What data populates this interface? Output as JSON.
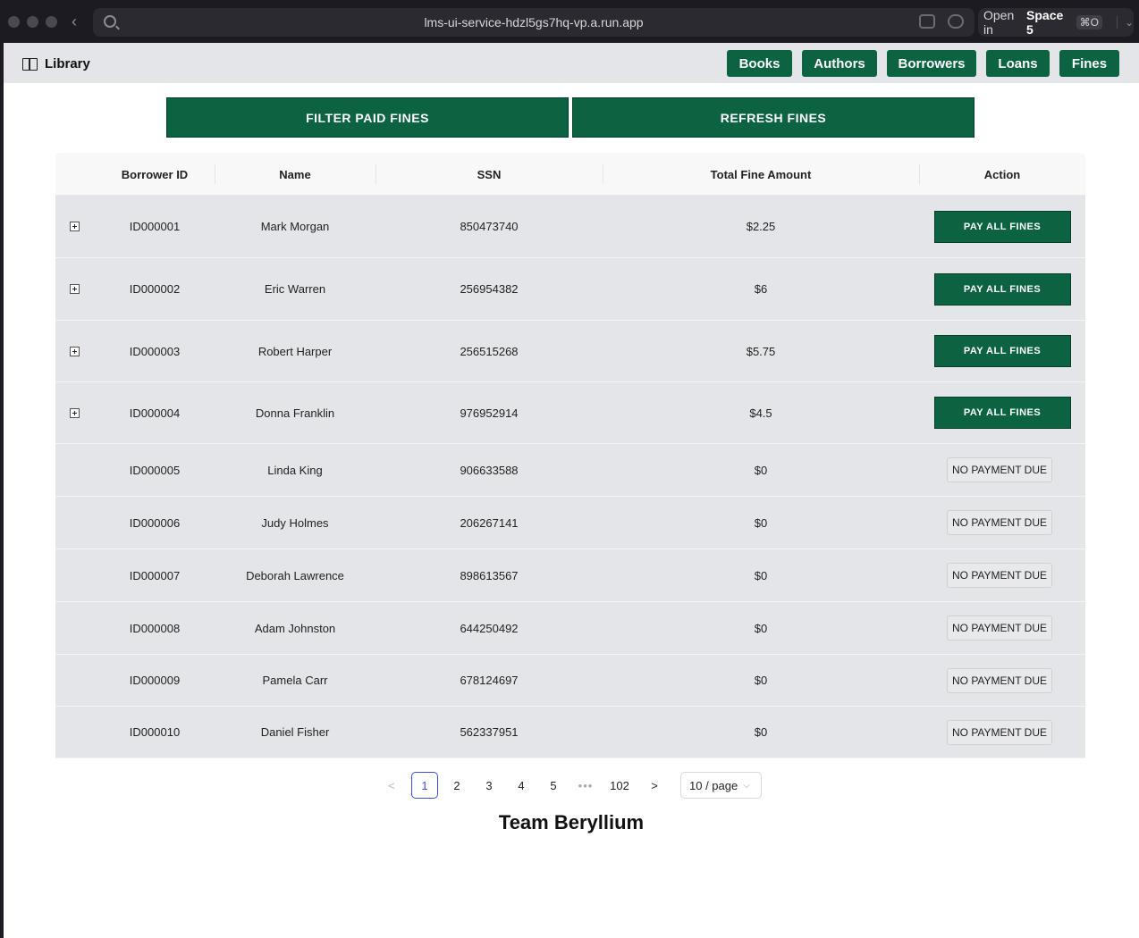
{
  "browser": {
    "url": "lms-ui-service-hdzl5gs7hq-vp.a.run.app",
    "open_in_prefix": "Open in",
    "space_name": "Space 5",
    "shortcut": "⌘O"
  },
  "header": {
    "brand": "Library",
    "nav": [
      "Books",
      "Authors",
      "Borrowers",
      "Loans",
      "Fines"
    ]
  },
  "actions": {
    "filter_label": "FILTER PAID FINES",
    "refresh_label": "REFRESH FINES"
  },
  "table": {
    "columns": [
      "Borrower ID",
      "Name",
      "SSN",
      "Total Fine Amount",
      "Action"
    ],
    "pay_label": "PAY ALL FINES",
    "no_pay_label": "NO PAYMENT DUE",
    "rows": [
      {
        "id": "ID000001",
        "name": "Mark Morgan",
        "ssn": "850473740",
        "amount": "$2.25",
        "payable": true
      },
      {
        "id": "ID000002",
        "name": "Eric Warren",
        "ssn": "256954382",
        "amount": "$6",
        "payable": true
      },
      {
        "id": "ID000003",
        "name": "Robert Harper",
        "ssn": "256515268",
        "amount": "$5.75",
        "payable": true
      },
      {
        "id": "ID000004",
        "name": "Donna Franklin",
        "ssn": "976952914",
        "amount": "$4.5",
        "payable": true
      },
      {
        "id": "ID000005",
        "name": "Linda King",
        "ssn": "906633588",
        "amount": "$0",
        "payable": false
      },
      {
        "id": "ID000006",
        "name": "Judy Holmes",
        "ssn": "206267141",
        "amount": "$0",
        "payable": false
      },
      {
        "id": "ID000007",
        "name": "Deborah Lawrence",
        "ssn": "898613567",
        "amount": "$0",
        "payable": false
      },
      {
        "id": "ID000008",
        "name": "Adam Johnston",
        "ssn": "644250492",
        "amount": "$0",
        "payable": false
      },
      {
        "id": "ID000009",
        "name": "Pamela Carr",
        "ssn": "678124697",
        "amount": "$0",
        "payable": false
      },
      {
        "id": "ID000010",
        "name": "Daniel Fisher",
        "ssn": "562337951",
        "amount": "$0",
        "payable": false
      }
    ]
  },
  "pagination": {
    "pages": [
      "1",
      "2",
      "3",
      "4",
      "5"
    ],
    "current": "1",
    "ellipsis": "•••",
    "last": "102",
    "prev": "<",
    "next": ">",
    "page_size": "10 / page"
  },
  "footer": "Team Beryllium",
  "colors": {
    "accent": "#0b6342",
    "row_bg": "#e4e5e8",
    "pager_active": "#3b4fd8"
  }
}
